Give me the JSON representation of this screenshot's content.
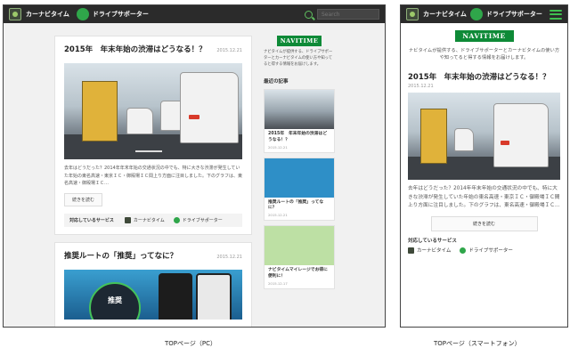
{
  "header": {
    "brand_navi": "カーナビタイム",
    "brand_drive": "ドライブサポーター",
    "search_placeholder": "Search"
  },
  "pc": {
    "article1": {
      "title": "2015年　年末年始の渋滞はどうなる！？",
      "date": "2015.12.21",
      "excerpt": "去年はどうだった？2014年年末年始の交通状況の中でも、特に大きな渋滞が発生していた年始の東名高速・東京ＩＣ・御殿場ＩＣ間上り方面に注目しました。下のグラフは、東名高速・御殿場ＩＣ…",
      "more": "続きを読む",
      "services_label": "対応しているサービス",
      "service1": "カーナビタイム",
      "service2": "ドライブサポーター"
    },
    "article2": {
      "title": "推奨ルートの「推奨」ってなに？",
      "date": "2015.12.21",
      "badge": "推奨"
    },
    "sidebar": {
      "logo": "NAVITIME",
      "desc": "ナビタイムが提供する、ドライブサポーターとカーナビタイムの使い方や知ってると得する情報をお届けします。",
      "recent_heading": "最近の記事",
      "items": [
        {
          "title": "2015年　年末年始の渋滞はどうなる！？",
          "date": "2015.12.21"
        },
        {
          "title": "推奨ルートの「推奨」ってなに？",
          "date": "2015.12.21"
        },
        {
          "title": "ナビタイムマイレージでお得に便利に！",
          "date": "2015.12.17"
        }
      ]
    }
  },
  "sp": {
    "logo": "NAVITIME",
    "desc": "ナビタイムが提供する、ドライブサポーターとカーナビタイムの使い方や知ってると得する情報をお届けします。",
    "title": "2015年　年末年始の渋滞はどうなる！？",
    "date": "2015.12.21",
    "excerpt": "去年はどうだった？2014年年末年始の交通状況の中でも、特に大きな渋滞が発生していた年始の東名高速・東京ＩＣ・御殿場ＩＣ間上り方面に注目しました。下のグラフは、東名高速・御殿場ＩＣ…",
    "more": "続きを読む",
    "services_label": "対応しているサービス",
    "service1": "カーナビタイム",
    "service2": "ドライブサポーター"
  },
  "captions": {
    "pc": "TOPページ（PC）",
    "sp": "TOPページ（スマートフォン）"
  },
  "colors": {
    "header_bg": "#2b2b2b",
    "brand_green": "#0e8a37",
    "accent_green": "#3fbf4f"
  }
}
